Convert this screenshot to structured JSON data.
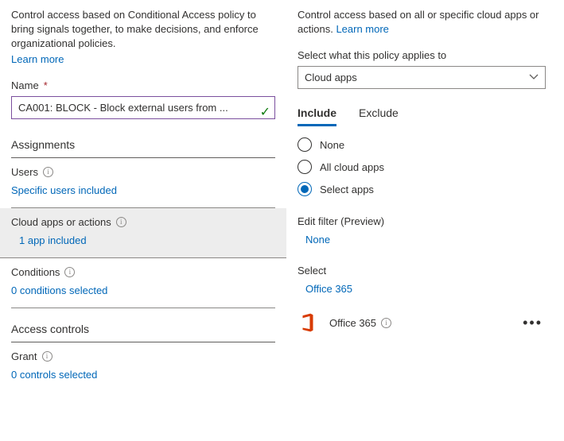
{
  "left": {
    "desc": "Control access based on Conditional Access policy to bring signals together, to make decisions, and enforce organizational policies.",
    "learn_more": "Learn more",
    "name_label": "Name",
    "name_value": "CA001: BLOCK - Block external users from ...",
    "sections": {
      "assignments": "Assignments",
      "access_controls": "Access controls"
    },
    "rows": {
      "users": {
        "label": "Users",
        "value": "Specific users included"
      },
      "cloud_apps": {
        "label": "Cloud apps or actions",
        "value": "1 app included"
      },
      "conditions": {
        "label": "Conditions",
        "value": "0 conditions selected"
      },
      "grant": {
        "label": "Grant",
        "value": "0 controls selected"
      }
    }
  },
  "right": {
    "desc": "Control access based on all or specific cloud apps or actions.",
    "learn_more": "Learn more",
    "applies_label": "Select what this policy applies to",
    "applies_value": "Cloud apps",
    "tabs": {
      "include": "Include",
      "exclude": "Exclude"
    },
    "radios": {
      "none": "None",
      "all": "All cloud apps",
      "select": "Select apps"
    },
    "edit_filter_label": "Edit filter (Preview)",
    "edit_filter_value": "None",
    "select_label": "Select",
    "select_value": "Office 365",
    "app": {
      "name": "Office 365"
    }
  }
}
